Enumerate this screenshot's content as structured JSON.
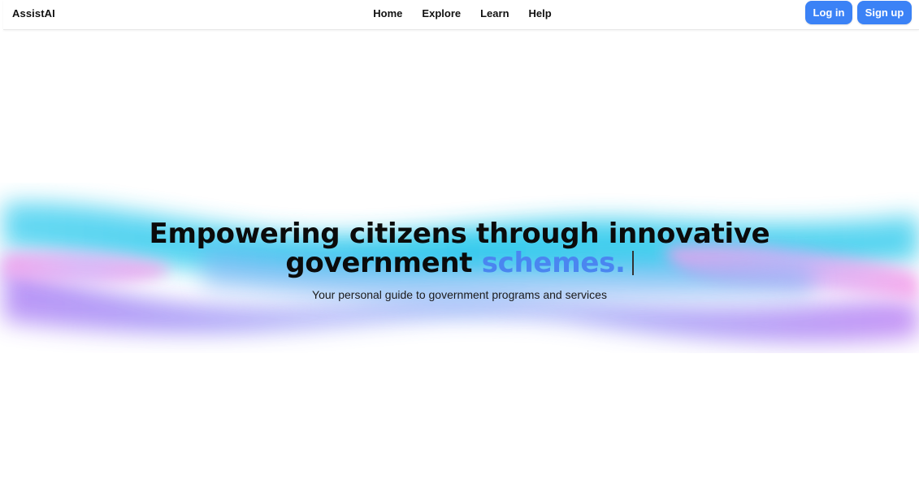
{
  "header": {
    "brand": "AssistAI",
    "nav": [
      "Home",
      "Explore",
      "Learn",
      "Help"
    ],
    "login_label": "Log in",
    "signup_label": "Sign up"
  },
  "hero": {
    "headline_line1": "Empowering citizens through innovative",
    "headline_line2_plain": "government ",
    "headline_line2_accent": "schemes.",
    "subtitle": "Your personal guide to government programs and services"
  },
  "colors": {
    "accent": "#3b82f6",
    "headline_accent": "#4a86f0",
    "wave_cyan": "#22d3ee",
    "wave_purple": "#a78bfa",
    "wave_pink": "#f0abfc"
  }
}
